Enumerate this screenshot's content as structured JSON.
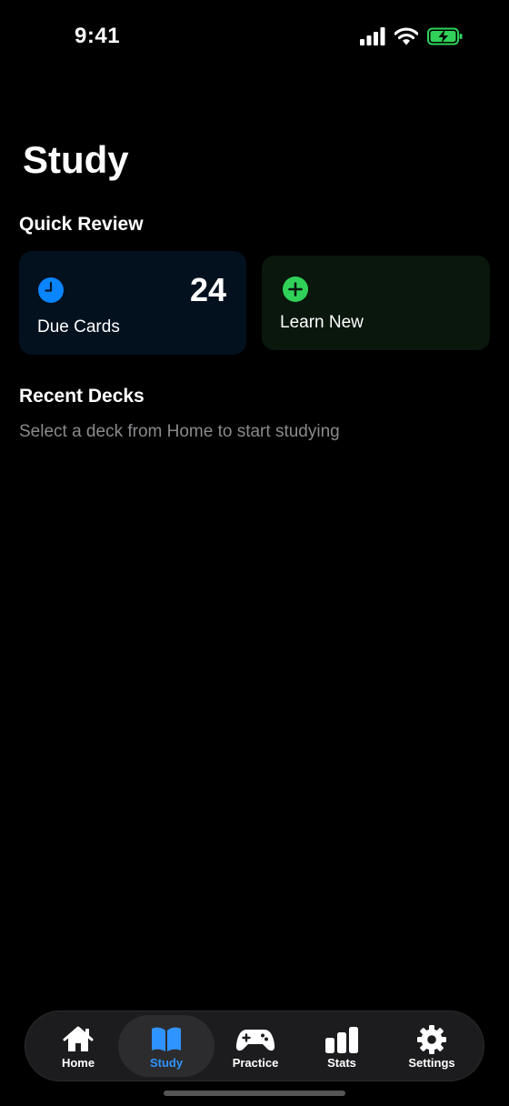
{
  "status_bar": {
    "time": "9:41"
  },
  "page_title": "Study",
  "quick_review": {
    "heading": "Quick Review",
    "due_card": {
      "count": "24",
      "label": "Due Cards",
      "icon": "clock-icon",
      "color": "#0a84ff"
    },
    "learn_card": {
      "label": "Learn New",
      "icon": "plus-circle-icon",
      "color": "#30d158"
    }
  },
  "recent_decks": {
    "heading": "Recent Decks",
    "empty_message": "Select a deck from Home to start studying"
  },
  "tab_bar": {
    "active_color": "#2f94ff",
    "tabs": [
      {
        "label": "Home",
        "icon": "house-icon",
        "active": false
      },
      {
        "label": "Study",
        "icon": "book-icon",
        "active": true
      },
      {
        "label": "Practice",
        "icon": "gamecontroller-icon",
        "active": false
      },
      {
        "label": "Stats",
        "icon": "chart-bar-icon",
        "active": false
      },
      {
        "label": "Settings",
        "icon": "gear-icon",
        "active": false
      }
    ]
  }
}
